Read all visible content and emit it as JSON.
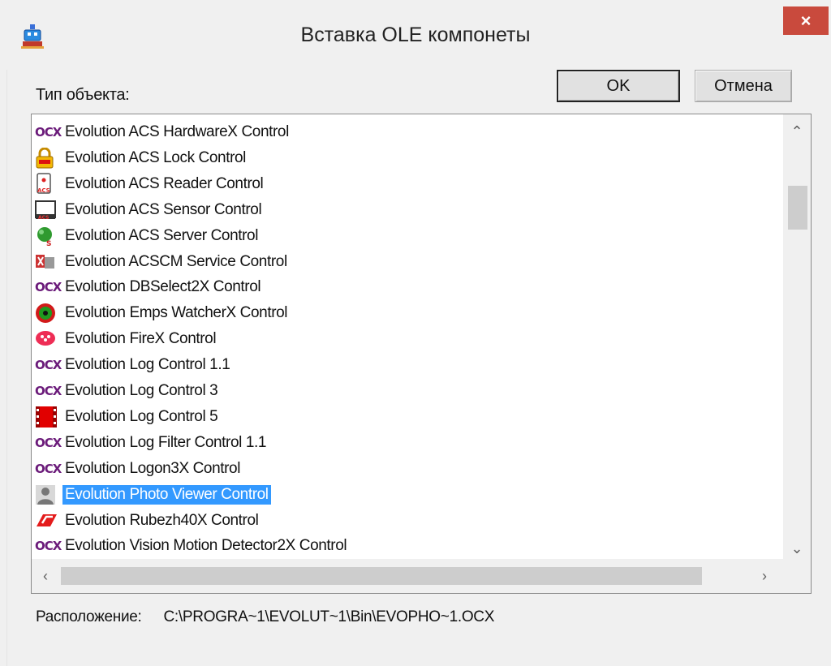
{
  "window": {
    "title": "Вставка OLE компонеты",
    "close_glyph": "×",
    "icon": "app-robot-icon"
  },
  "object_type_label": "Тип объекта:",
  "buttons": {
    "ok": "OK",
    "cancel": "Отмена"
  },
  "list": {
    "items": [
      {
        "label": "Evolution ACS HardwareX Control",
        "icon": "ocx-icon",
        "ocx": "OCX"
      },
      {
        "label": "Evolution ACS Lock Control",
        "icon": "lock-icon"
      },
      {
        "label": "Evolution ACS Reader Control",
        "icon": "reader-icon"
      },
      {
        "label": "Evolution ACS Sensor Control",
        "icon": "sensor-icon"
      },
      {
        "label": "Evolution ACS Server Control",
        "icon": "server-icon"
      },
      {
        "label": "Evolution ACSCM Service Control",
        "icon": "service-icon"
      },
      {
        "label": "Evolution DBSelect2X Control",
        "icon": "ocx-icon",
        "ocx": "OCX"
      },
      {
        "label": "Evolution Emps WatcherX Control",
        "icon": "watcher-icon"
      },
      {
        "label": "Evolution FireX Control",
        "icon": "fire-icon"
      },
      {
        "label": "Evolution Log Control 1.1",
        "icon": "ocx-icon",
        "ocx": "OCX"
      },
      {
        "label": "Evolution Log Control 3",
        "icon": "ocx-icon",
        "ocx": "OCX"
      },
      {
        "label": "Evolution Log Control 5",
        "icon": "log-film-icon"
      },
      {
        "label": "Evolution Log Filter Control 1.1",
        "icon": "ocx-icon",
        "ocx": "OCX"
      },
      {
        "label": "Evolution Logon3X Control",
        "icon": "ocx-icon",
        "ocx": "OCX"
      },
      {
        "label": "Evolution Photo Viewer Control",
        "icon": "photo-person-icon",
        "selected": true
      },
      {
        "label": "Evolution Rubezh40X Control",
        "icon": "rubezh-icon"
      },
      {
        "label": "Evolution Vision Motion Detector2X Control",
        "icon": "ocx-icon",
        "ocx": "OCX"
      }
    ],
    "selected_index": 14
  },
  "scroll": {
    "up": "⌃",
    "down": "⌄",
    "left": "‹",
    "right": "›"
  },
  "location": {
    "label": "Расположение:",
    "path": "C:\\PROGRA~1\\EVOLUT~1\\Bin\\EVOPHO~1.OCX"
  }
}
